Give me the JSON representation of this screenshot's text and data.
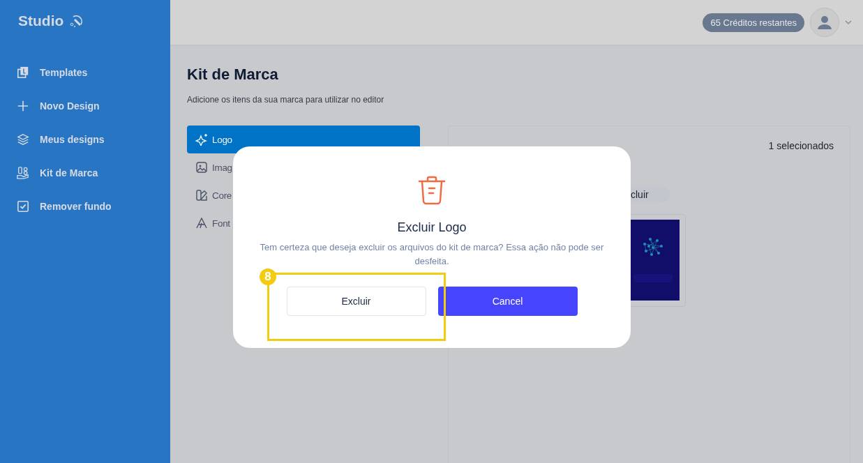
{
  "sidebar": {
    "brand": "Studio",
    "items": [
      {
        "label": "Templates"
      },
      {
        "label": "Novo Design"
      },
      {
        "label": "Meus designs"
      },
      {
        "label": "Kit de Marca"
      },
      {
        "label": "Remover fundo"
      }
    ]
  },
  "header": {
    "credits": "65 Créditos restantes"
  },
  "page": {
    "title": "Kit de Marca",
    "subtitle": "Adicione os itens da sua marca para utilizar no editor"
  },
  "brand_nav": [
    {
      "label": "Logo",
      "selected": true
    },
    {
      "label": "Imag",
      "selected": false
    },
    {
      "label": "Core",
      "selected": false
    },
    {
      "label": "Font",
      "selected": false
    }
  ],
  "panel": {
    "count": "1 selecionados",
    "action": "cluir"
  },
  "dialog": {
    "title": "Excluir Logo",
    "message": "Tem certeza que deseja excluir os arquivos do kit de marca? Essa ação não pode ser desfeita.",
    "buttons": [
      {
        "label": "Excluir",
        "kind": "secondary"
      },
      {
        "label": "Cancel",
        "kind": "primary"
      }
    ]
  },
  "annotation": {
    "step": "8"
  }
}
